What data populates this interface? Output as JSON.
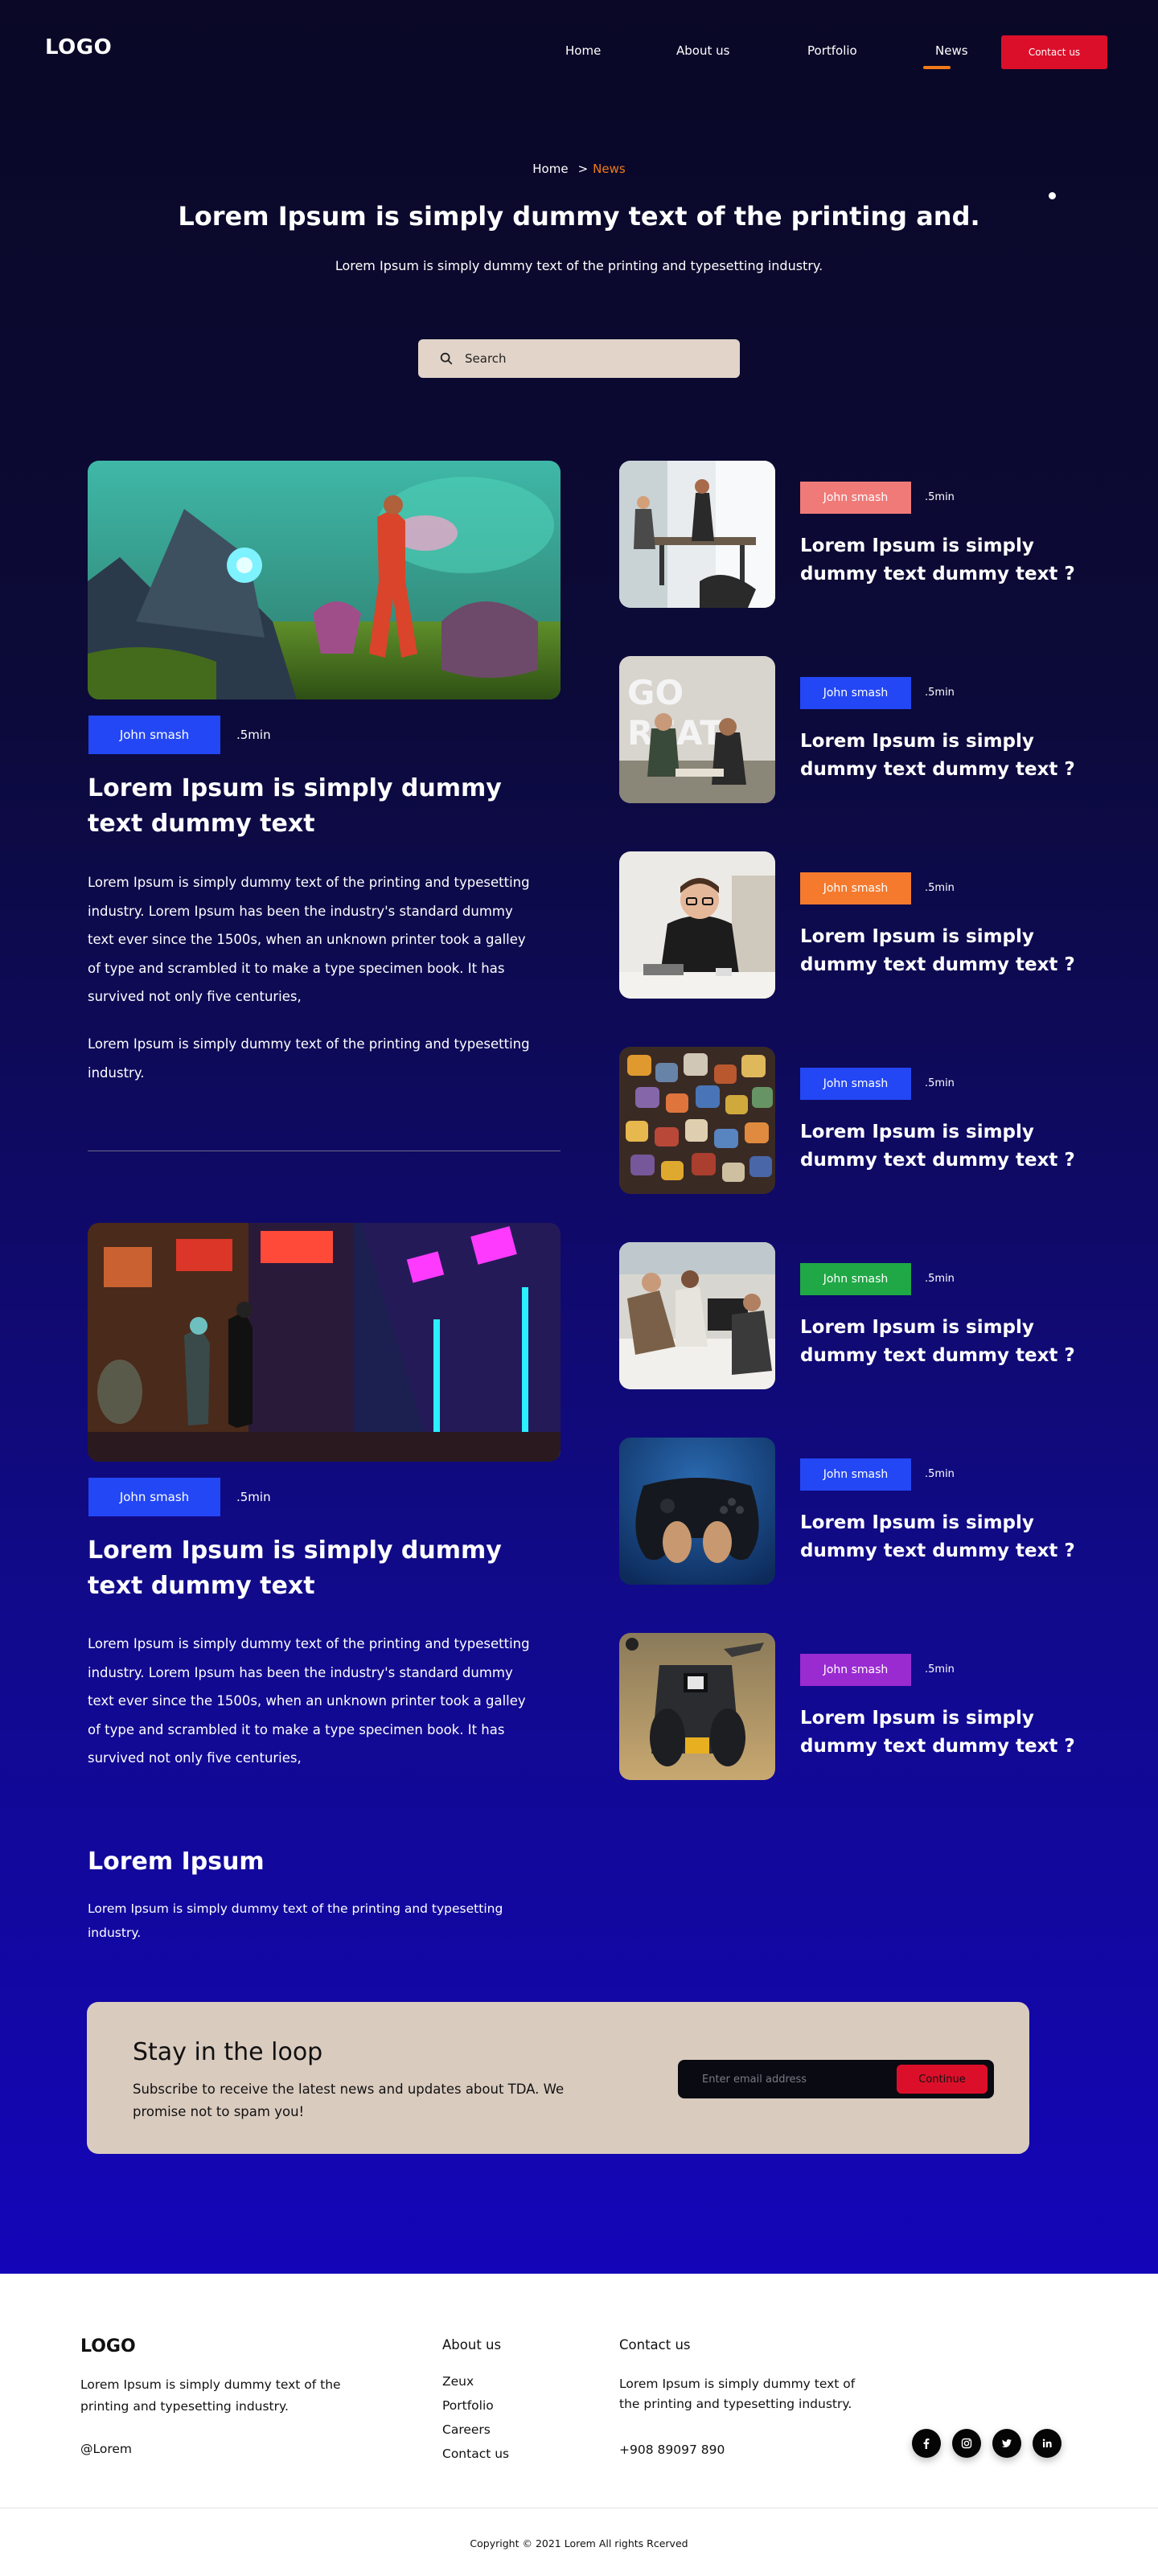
{
  "nav": {
    "logo": "LOGO",
    "items": [
      {
        "label": "Home"
      },
      {
        "label": "About us"
      },
      {
        "label": "Portfolio"
      },
      {
        "label": "News"
      }
    ],
    "contact_label": "Contact us",
    "accent": "#f07a1a",
    "button_color": "#dc0f2a"
  },
  "header": {
    "breadcrumb": [
      "Home",
      ">",
      "News"
    ],
    "title": "Lorem Ipsum is simply dummy text of the printing and.",
    "subtitle": "Lorem Ipsum is simply dummy text of the printing and typesetting industry.",
    "search_placeholder": "Search"
  },
  "featured": [
    {
      "tag": "John smash",
      "tag_color": "#2347f5",
      "read_time": ".5min",
      "title": "Lorem Ipsum is simply dummy text dummy text",
      "paragraphs": [
        "Lorem Ipsum is simply dummy text of the printing and typesetting industry. Lorem Ipsum has been the industry's standard dummy text ever since the 1500s, when an unknown printer took a galley of type and scrambled it to make a type specimen book. It has survived not only five centuries,",
        "Lorem Ipsum is simply dummy text of the printing and typesetting industry."
      ]
    },
    {
      "tag": "John smash",
      "tag_color": "#2347f5",
      "read_time": ".5min",
      "title": "Lorem Ipsum is simply dummy text dummy text",
      "paragraphs": [
        "Lorem Ipsum is simply dummy text of the printing and typesetting industry. Lorem Ipsum has been the industry's standard dummy text ever since the 1500s, when an unknown printer took a galley of type and scrambled it to make a type specimen book. It has survived not only five centuries,"
      ]
    }
  ],
  "side_posts": [
    {
      "tag": "John smash",
      "tag_color": "#f07a78",
      "read_time": ".5min",
      "title": "Lorem Ipsum is simply dummy text dummy text ?"
    },
    {
      "tag": "John smash",
      "tag_color": "#2347f5",
      "read_time": ".5min",
      "title": "Lorem Ipsum is simply dummy text dummy text ?"
    },
    {
      "tag": "John smash",
      "tag_color": "#f57a2e",
      "read_time": ".5min",
      "title": "Lorem Ipsum is simply dummy text dummy text ?"
    },
    {
      "tag": "John smash",
      "tag_color": "#2347f5",
      "read_time": ".5min",
      "title": "Lorem Ipsum is simply dummy text dummy text ?"
    },
    {
      "tag": "John smash",
      "tag_color": "#1fa845",
      "read_time": ".5min",
      "title": "Lorem Ipsum is simply dummy text dummy text ?"
    },
    {
      "tag": "John smash",
      "tag_color": "#2347f5",
      "read_time": ".5min",
      "title": "Lorem Ipsum is simply dummy text dummy text ?"
    },
    {
      "tag": "John smash",
      "tag_color": "#9a2bd1",
      "read_time": ".5min",
      "title": "Lorem Ipsum is simply dummy text dummy text ?"
    }
  ],
  "ipsum": {
    "title": "Lorem Ipsum",
    "text": "Lorem Ipsum is simply dummy text of the printing and typesetting industry."
  },
  "newsletter": {
    "title": "Stay in the loop",
    "text": "Subscribe to receive the latest news and updates about TDA. We promise not to spam you!",
    "email_placeholder": "Enter email address",
    "button_label": "Continue"
  },
  "footer": {
    "logo": "LOGO",
    "description": "Lorem Ipsum is simply dummy text of the printing and typesetting industry.",
    "handle": "@Lorem",
    "about_heading": "About us",
    "about_links": [
      "Zeux",
      "Portfolio",
      "Careers",
      "Contact us"
    ],
    "contact_heading": "Contact us",
    "contact_text": "Lorem Ipsum is simply dummy text of the printing and typesetting industry.",
    "phone": "+908 89097 890",
    "social": [
      "facebook-icon",
      "instagram-icon",
      "twitter-icon",
      "linkedin-icon"
    ],
    "copyright": "Copyright © 2021 Lorem All rights Rcerved"
  }
}
